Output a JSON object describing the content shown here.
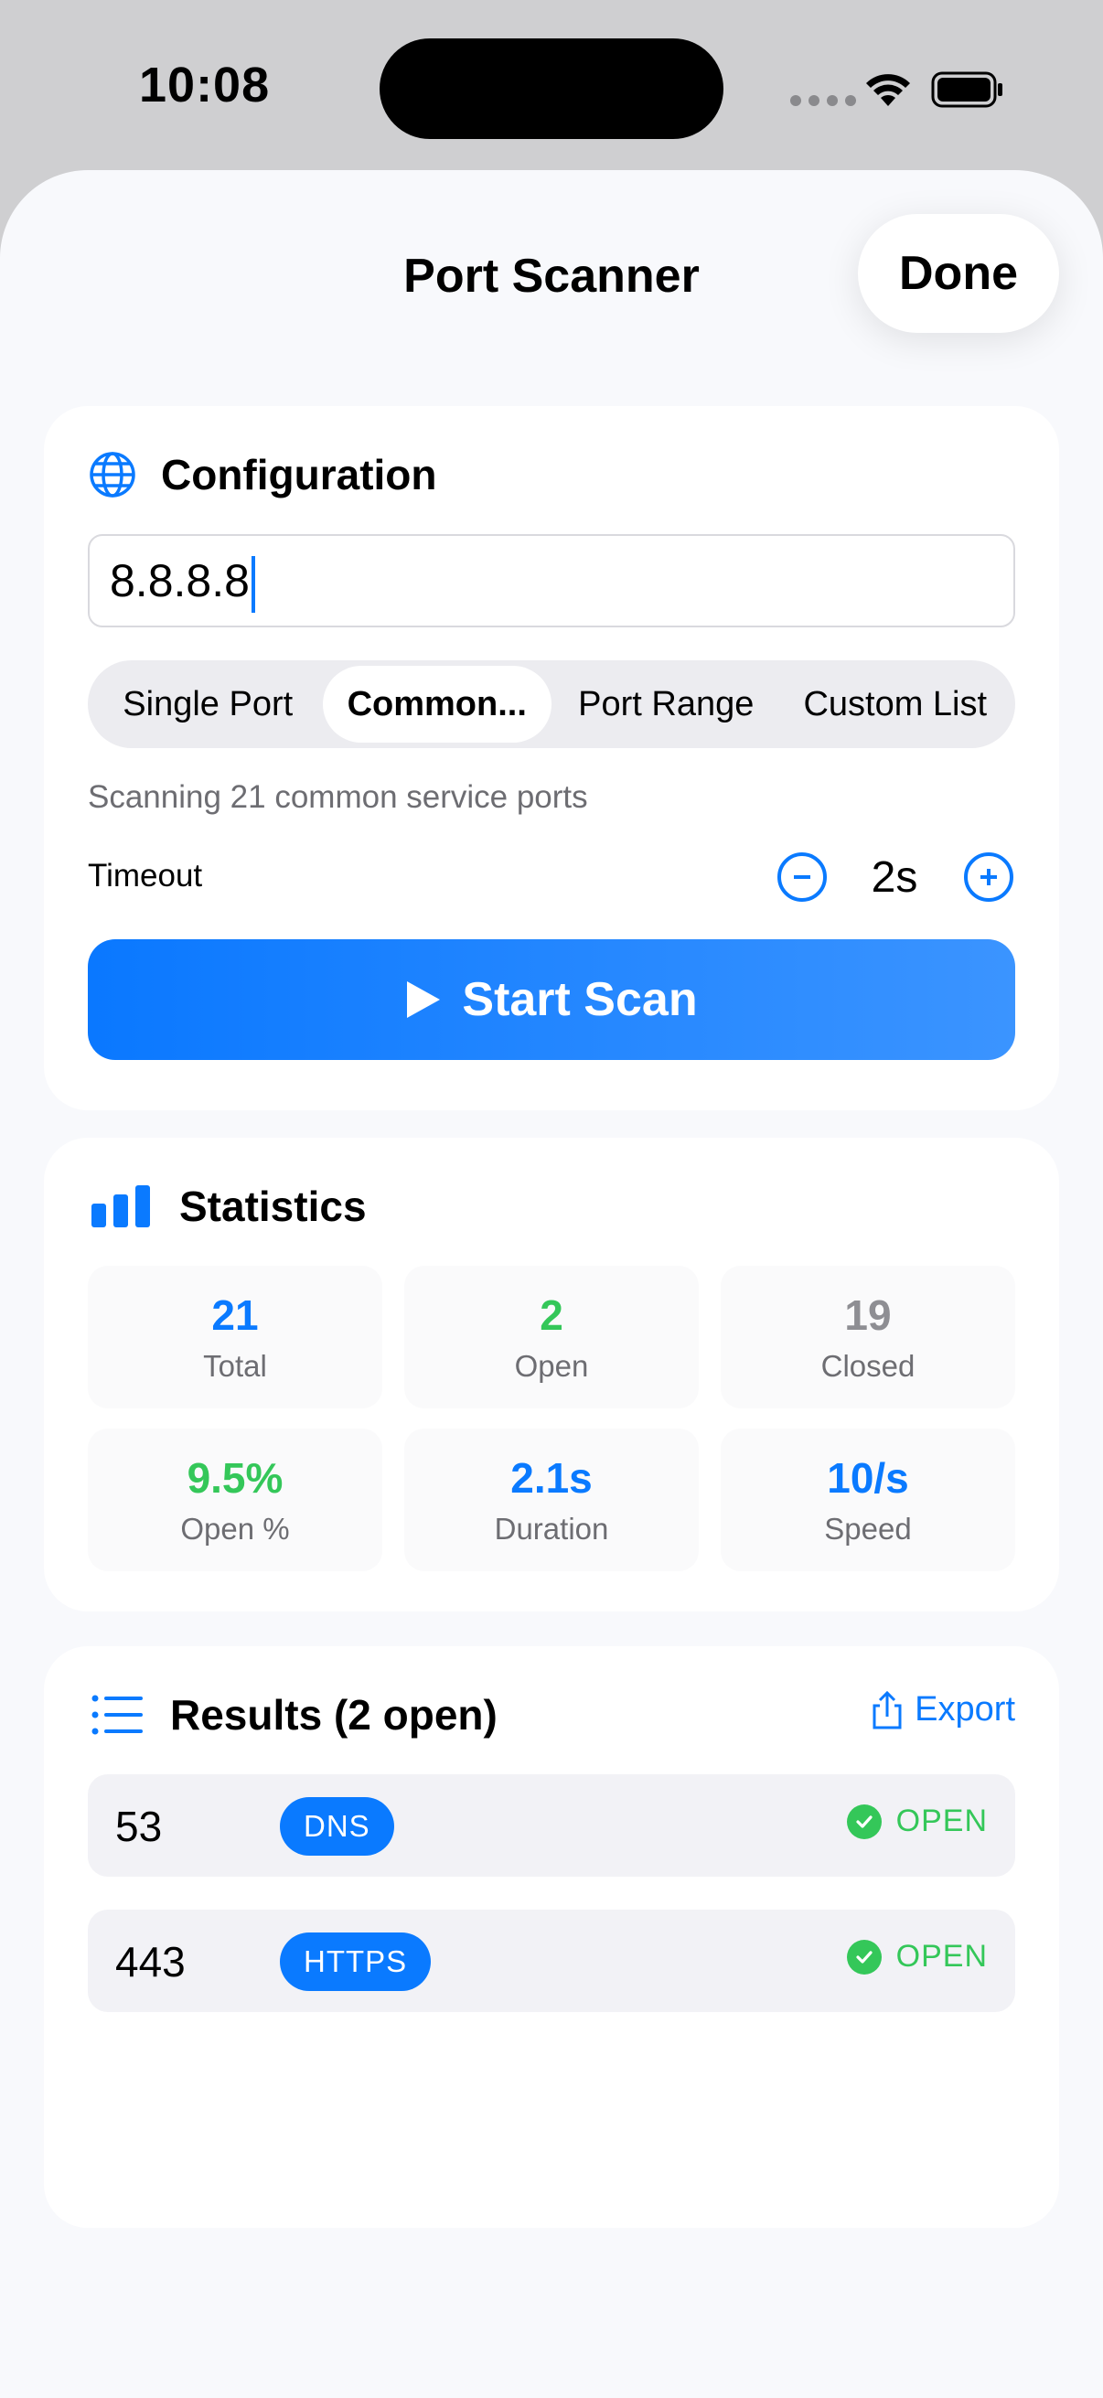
{
  "status_bar": {
    "time": "10:08"
  },
  "sheet": {
    "title": "Port Scanner",
    "done_label": "Done"
  },
  "configuration": {
    "title": "Configuration",
    "icon": "globe-icon",
    "host_value": "8.8.8.8",
    "modes": [
      "Single Port",
      "Common...",
      "Port Range",
      "Custom List"
    ],
    "selected_mode": "Common...",
    "description": "Scanning 21 common service ports",
    "timeout_label": "Timeout",
    "timeout_value": "2s",
    "start_label": "Start Scan"
  },
  "statistics": {
    "title": "Statistics",
    "icon": "bar-chart-icon",
    "items": [
      {
        "value": "21",
        "label": "Total",
        "color": "#0a7aff"
      },
      {
        "value": "2",
        "label": "Open",
        "color": "#34c759"
      },
      {
        "value": "19",
        "label": "Closed",
        "color": "#8e8e93"
      },
      {
        "value": "9.5%",
        "label": "Open %",
        "color": "#34c759"
      },
      {
        "value": "2.1s",
        "label": "Duration",
        "color": "#0a7aff"
      },
      {
        "value": "10/s",
        "label": "Speed",
        "color": "#0a7aff"
      }
    ]
  },
  "results": {
    "title": "Results (2 open)",
    "icon": "list-icon",
    "export_label": "Export",
    "rows": [
      {
        "port": "53",
        "service": "DNS",
        "status": "OPEN"
      },
      {
        "port": "443",
        "service": "HTTPS",
        "status": "OPEN"
      }
    ]
  },
  "colors": {
    "accent": "#0a7aff",
    "open": "#34c759",
    "closed": "#8e8e93"
  }
}
